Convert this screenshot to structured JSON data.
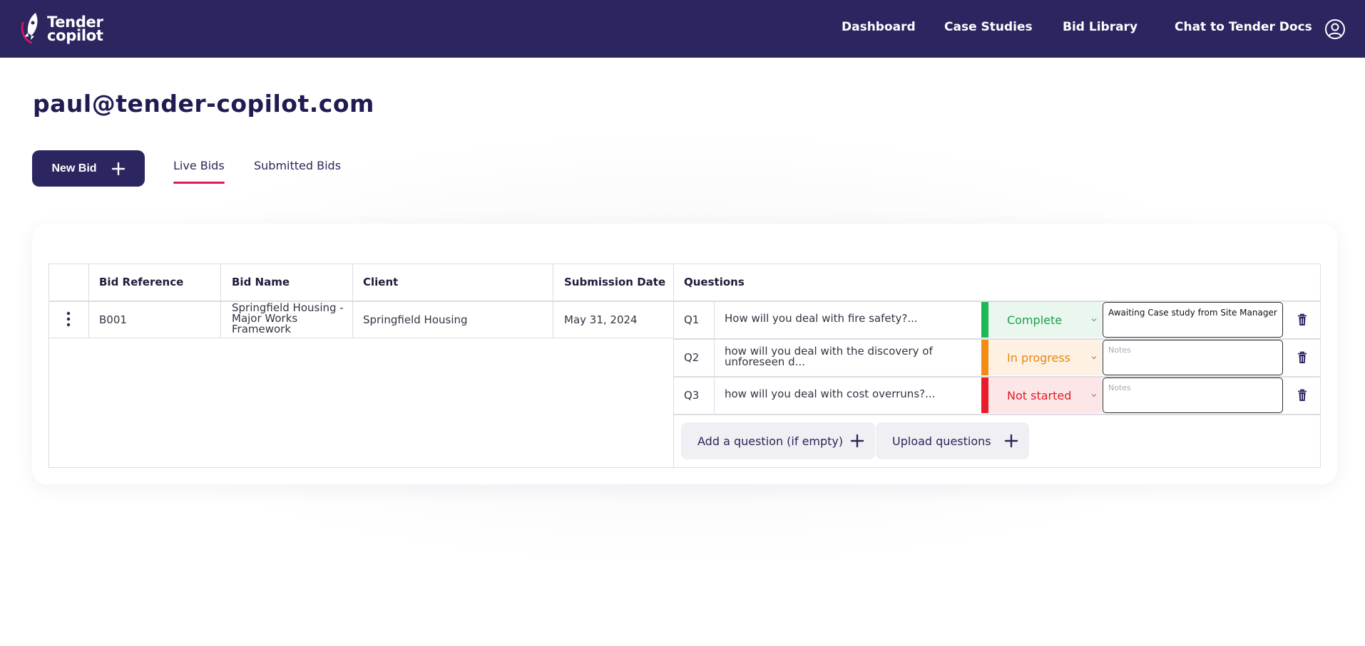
{
  "brand": {
    "line1": "Tender",
    "line2": "copilot"
  },
  "nav": {
    "items": [
      "Dashboard",
      "Case Studies",
      "Bid Library",
      "Chat to Tender Docs"
    ]
  },
  "user": {
    "email": "paul@tender-copilot.com"
  },
  "actions": {
    "new_bid": "New Bid"
  },
  "tabs": {
    "live": "Live Bids",
    "submitted": "Submitted Bids",
    "active": "live"
  },
  "table": {
    "headers": {
      "bid_reference": "Bid Reference",
      "bid_name": "Bid Name",
      "client": "Client",
      "submission_date": "Submission Date",
      "questions": "Questions"
    },
    "rows": [
      {
        "bid_reference": "B001",
        "bid_name": "Springfield Housing - Major Works Framework",
        "client": "Springfield Housing",
        "submission_date": "May 31, 2024",
        "questions": [
          {
            "number": "Q1",
            "text": "How will you deal with fire safety?...",
            "status": "Complete",
            "notes": "Awaiting Case study from Site Manager",
            "notes_placeholder": "Notes"
          },
          {
            "number": "Q2",
            "text": "how will you deal with the discovery of unforeseen d...",
            "status": "In progress",
            "notes": "",
            "notes_placeholder": "Notes"
          },
          {
            "number": "Q3",
            "text": "how will you deal with cost overruns?...",
            "status": "Not started",
            "notes": "",
            "notes_placeholder": "Notes"
          }
        ],
        "add_question": "Add a question (if empty)",
        "upload_questions": "Upload questions"
      }
    ]
  },
  "status_colors": {
    "Complete": {
      "bar": "#1db954",
      "bg": "#eaf7ee",
      "text": "#1e9e4a"
    },
    "In progress": {
      "bar": "#f28c13",
      "bg": "#fef1e3",
      "text": "#e8870e"
    },
    "Not started": {
      "bar": "#ea1c2a",
      "bg": "#fde6e7",
      "text": "#e01b27"
    }
  },
  "colors": {
    "nav_bg": "#2b2660",
    "accent": "#e0195d"
  }
}
